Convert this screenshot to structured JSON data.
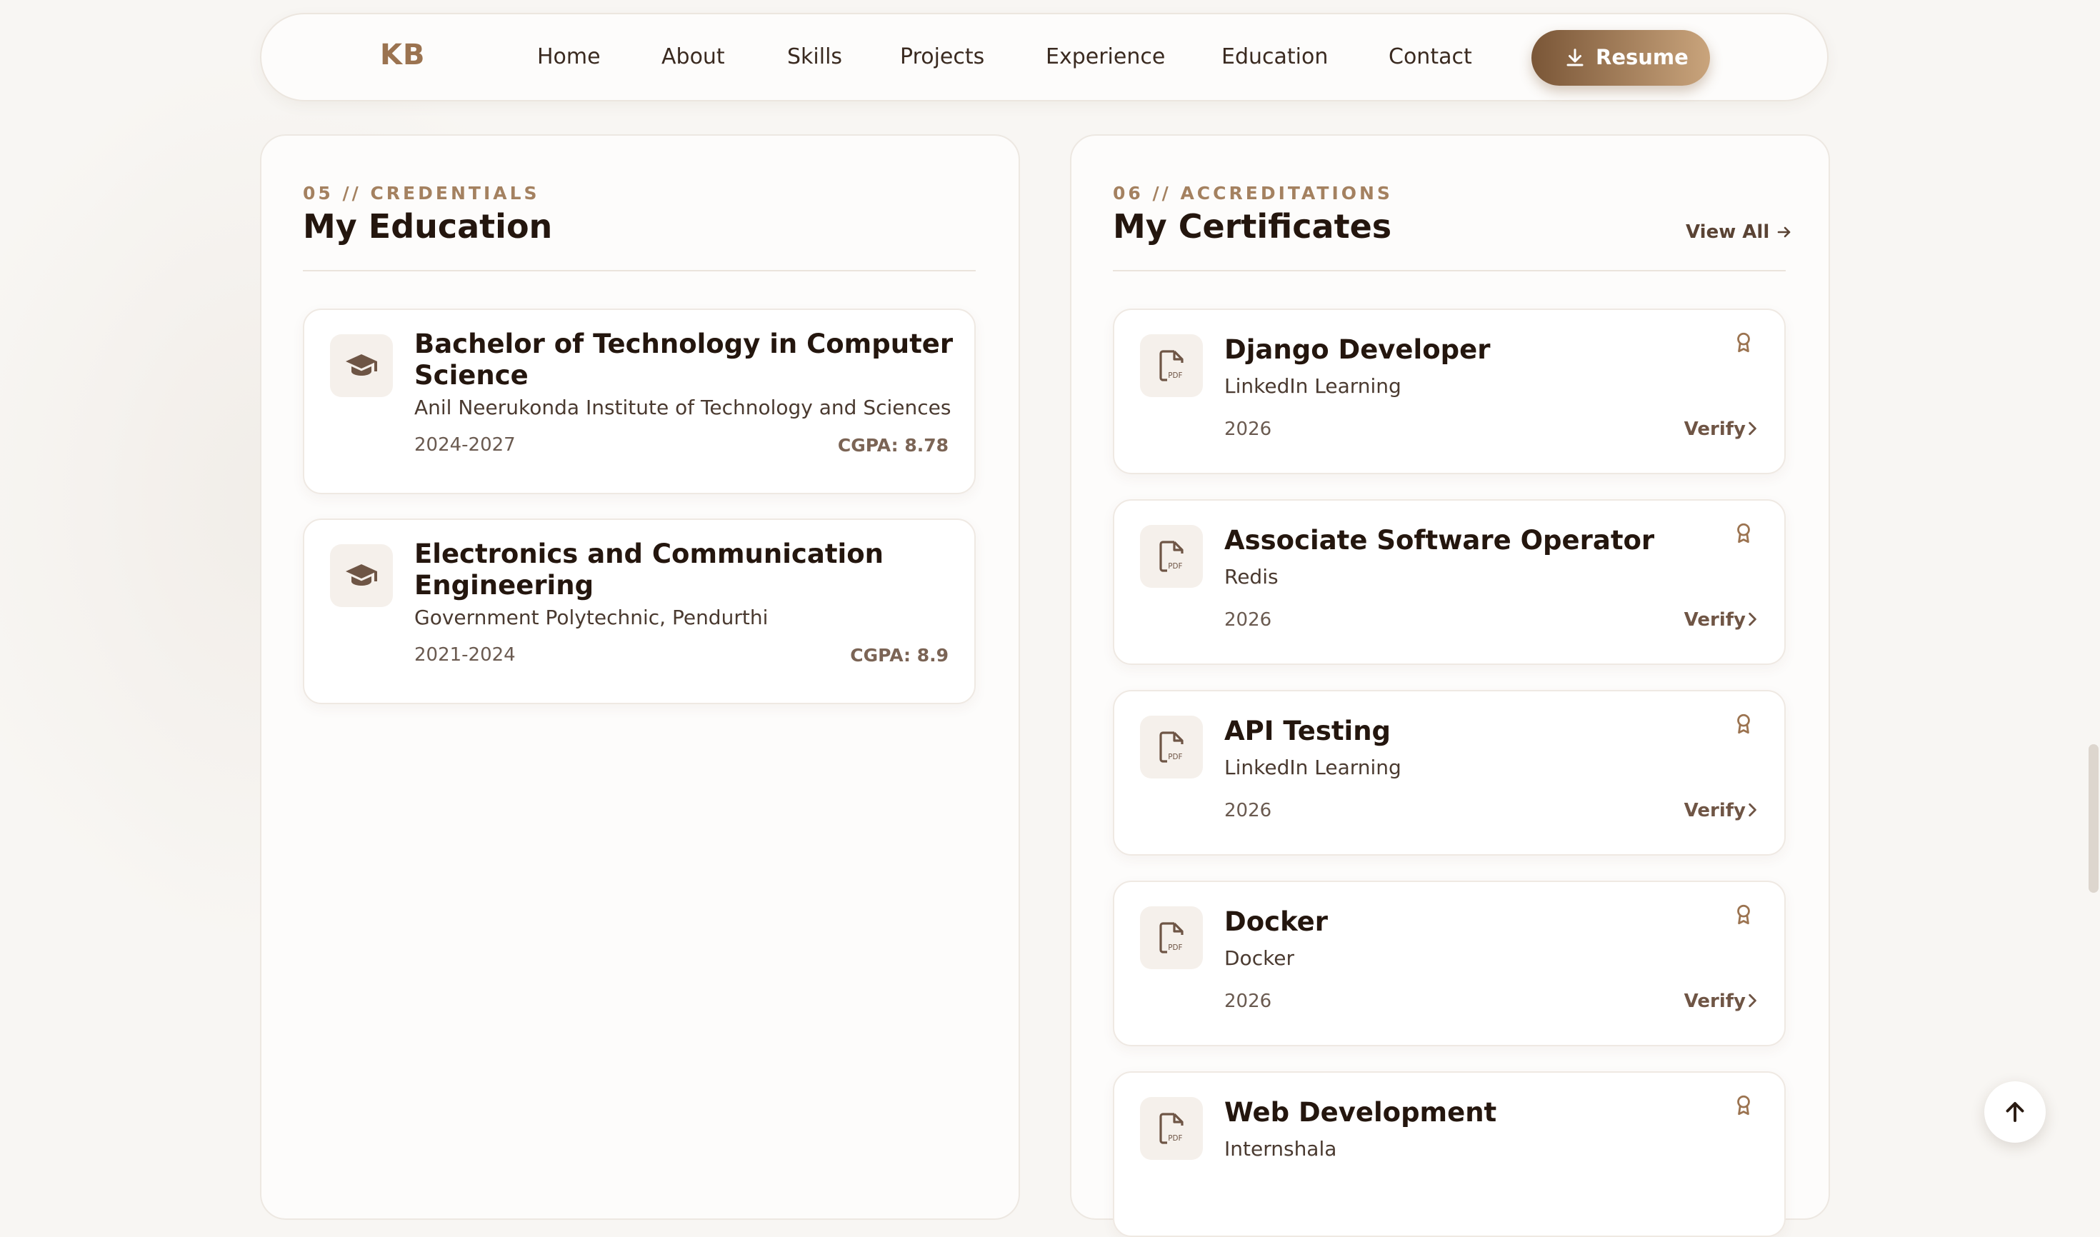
{
  "nav": {
    "logo": "KB",
    "links": [
      "Home",
      "About",
      "Skills",
      "Projects",
      "Experience",
      "Education",
      "Contact"
    ],
    "resume_label": "Resume",
    "resume_icon": "download-icon"
  },
  "education": {
    "eyebrow": "05 // CREDENTIALS",
    "title": "My Education",
    "icon": "graduation-cap-icon",
    "items": [
      {
        "degree_line1": "Bachelor of Technology in Computer",
        "degree_line2": "Science",
        "institution": "Anil Neerukonda Institute of Technology and Sciences",
        "years": "2024-2027",
        "cgpa": "CGPA: 8.78"
      },
      {
        "degree_line1": "Electronics and Communication",
        "degree_line2": "Engineering",
        "institution": "Government Polytechnic, Pendurthi",
        "years": "2021-2024",
        "cgpa": "CGPA: 8.9"
      }
    ]
  },
  "certificates": {
    "eyebrow": "06 // ACCREDITATIONS",
    "title": "My Certificates",
    "view_all": "View All",
    "icon": "pdf-file-icon",
    "badge_icon": "award-ribbon-icon",
    "verify_label": "Verify",
    "items": [
      {
        "name": "Django Developer",
        "issuer": "LinkedIn Learning",
        "year": "2026"
      },
      {
        "name": "Associate Software Operator",
        "issuer": "Redis",
        "year": "2026"
      },
      {
        "name": "API Testing",
        "issuer": "LinkedIn Learning",
        "year": "2026"
      },
      {
        "name": "Docker",
        "issuer": "Docker",
        "year": "2026"
      },
      {
        "name": "Web Development",
        "issuer": "Internshala",
        "year": ""
      }
    ]
  },
  "colors": {
    "accent": "#9b7350",
    "accent_dark": "#7a5637",
    "title": "#24160e",
    "background": "#f8f6f3"
  },
  "scroll_to_top_icon": "arrow-up-icon"
}
